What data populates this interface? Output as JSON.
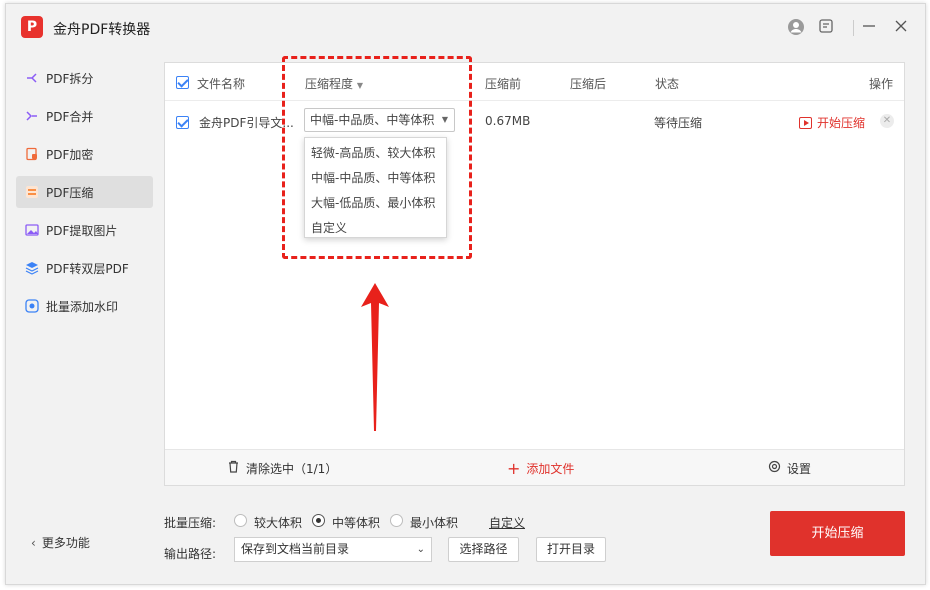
{
  "app": {
    "logo_text": "P",
    "title": "金舟PDF转换器"
  },
  "titlebar_icons": [
    "user-icon",
    "feedback-icon",
    "minimize-icon",
    "close-icon"
  ],
  "sidebar": {
    "items": [
      {
        "label": "PDF拆分",
        "icon": "split-icon",
        "color": "#8b5cf6"
      },
      {
        "label": "PDF合并",
        "icon": "merge-icon",
        "color": "#8b5cf6"
      },
      {
        "label": "PDF加密",
        "icon": "lock-icon",
        "color": "#ef6a3a"
      },
      {
        "label": "PDF压缩",
        "icon": "compress-icon",
        "color": "#f97316",
        "active": true
      },
      {
        "label": "PDF提取图片",
        "icon": "image-icon",
        "color": "#8b5cf6"
      },
      {
        "label": "PDF转双层PDF",
        "icon": "layers-icon",
        "color": "#3b82f6"
      },
      {
        "label": "批量添加水印",
        "icon": "watermark-icon",
        "color": "#3b82f6"
      }
    ],
    "more_label": "更多功能"
  },
  "table": {
    "headers": {
      "name": "文件名称",
      "level": "压缩程度",
      "before": "压缩前",
      "after": "压缩后",
      "status": "状态",
      "action": "操作"
    },
    "rows": [
      {
        "name": "金舟PDF引导文...",
        "level": "中幅-中品质、中等体积",
        "before": "0.67MB",
        "after": "",
        "status": "等待压缩",
        "action": "开始压缩",
        "checked": true
      }
    ]
  },
  "level_options": [
    "轻微-高品质、较大体积",
    "中幅-中品质、中等体积",
    "大幅-低品质、最小体积",
    "自定义"
  ],
  "panel_footer": {
    "clear": "清除选中（1/1）",
    "add": "添加文件",
    "settings": "设置"
  },
  "batch": {
    "label": "批量压缩:",
    "options": [
      {
        "label": "较大体积",
        "checked": false
      },
      {
        "label": "中等体积",
        "checked": true
      },
      {
        "label": "最小体积",
        "checked": false
      }
    ],
    "custom": "自定义"
  },
  "output": {
    "label": "输出路径:",
    "value": "保存到文档当前目录",
    "choose": "选择路径",
    "open": "打开目录"
  },
  "start_button": "开始压缩",
  "colors": {
    "accent": "#e0322c",
    "checkbox": "#3b82f6",
    "annotation": "#e8211b"
  }
}
